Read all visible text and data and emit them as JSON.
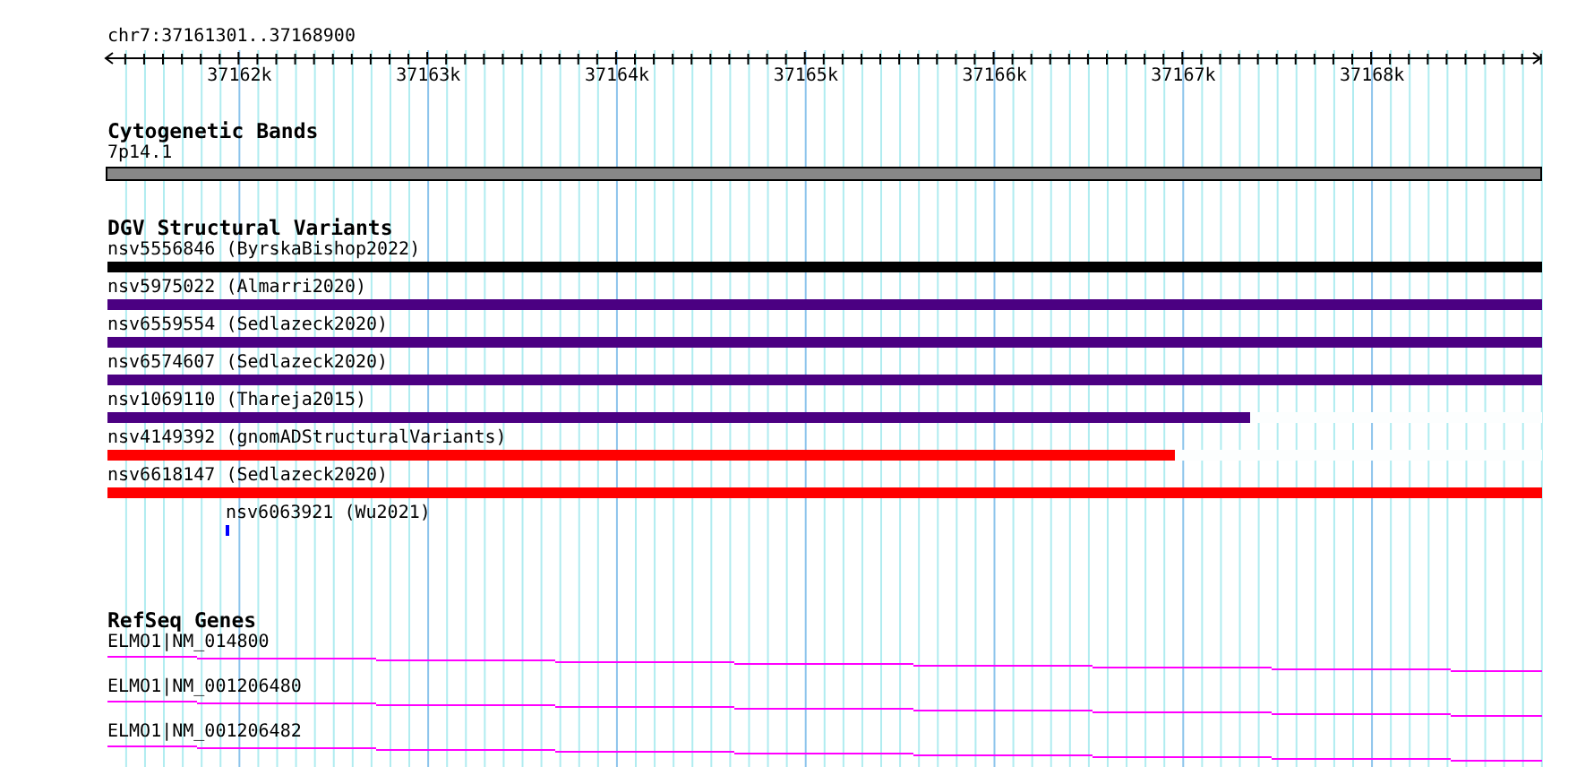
{
  "ruler": {
    "location": "chr7:37161301..37168900",
    "tick_labels": [
      "37162k",
      "37163k",
      "37164k",
      "37165k",
      "37166k",
      "37167k",
      "37168k"
    ]
  },
  "cytogenetic_bands": {
    "title": "Cytogenetic Bands",
    "band": "7p14.1"
  },
  "dgv_structural_variants": {
    "title": "DGV Structural Variants",
    "variants": [
      {
        "label": "nsv5556846 (ByrskaBishop2022)",
        "kind": "bar",
        "color": "#000000",
        "level": 1
      },
      {
        "label": "nsv5975022 (Almarri2020)",
        "kind": "bar",
        "color": "#4b0082",
        "level": 1
      },
      {
        "label": "nsv6559554 (Sedlazeck2020)",
        "kind": "bar",
        "color": "#4b0082",
        "level": 1
      },
      {
        "label": "nsv6574607 (Sedlazeck2020)",
        "kind": "bar",
        "color": "#4b0082",
        "level": 1
      },
      {
        "label": "nsv1069110 (Thareja2015)",
        "kind": "bar",
        "color": "#4b0082",
        "level": 0.797
      },
      {
        "label": "nsv4149392 (gnomADStructuralVariants)",
        "kind": "bar",
        "color": "#ff0000",
        "level": 0.744
      },
      {
        "label": "nsv6618147 (Sedlazeck2020)",
        "kind": "bar",
        "color": "#ff0000",
        "level": 1
      },
      {
        "label": "nsv6063921 (Wu2021)",
        "kind": "marker",
        "color": "#0000ff"
      }
    ]
  },
  "refseq_genes": {
    "title": "RefSeq Genes",
    "genes": [
      "ELMO1|NM_014800",
      "ELMO1|NM_001206480",
      "ELMO1|NM_001206482"
    ]
  }
}
